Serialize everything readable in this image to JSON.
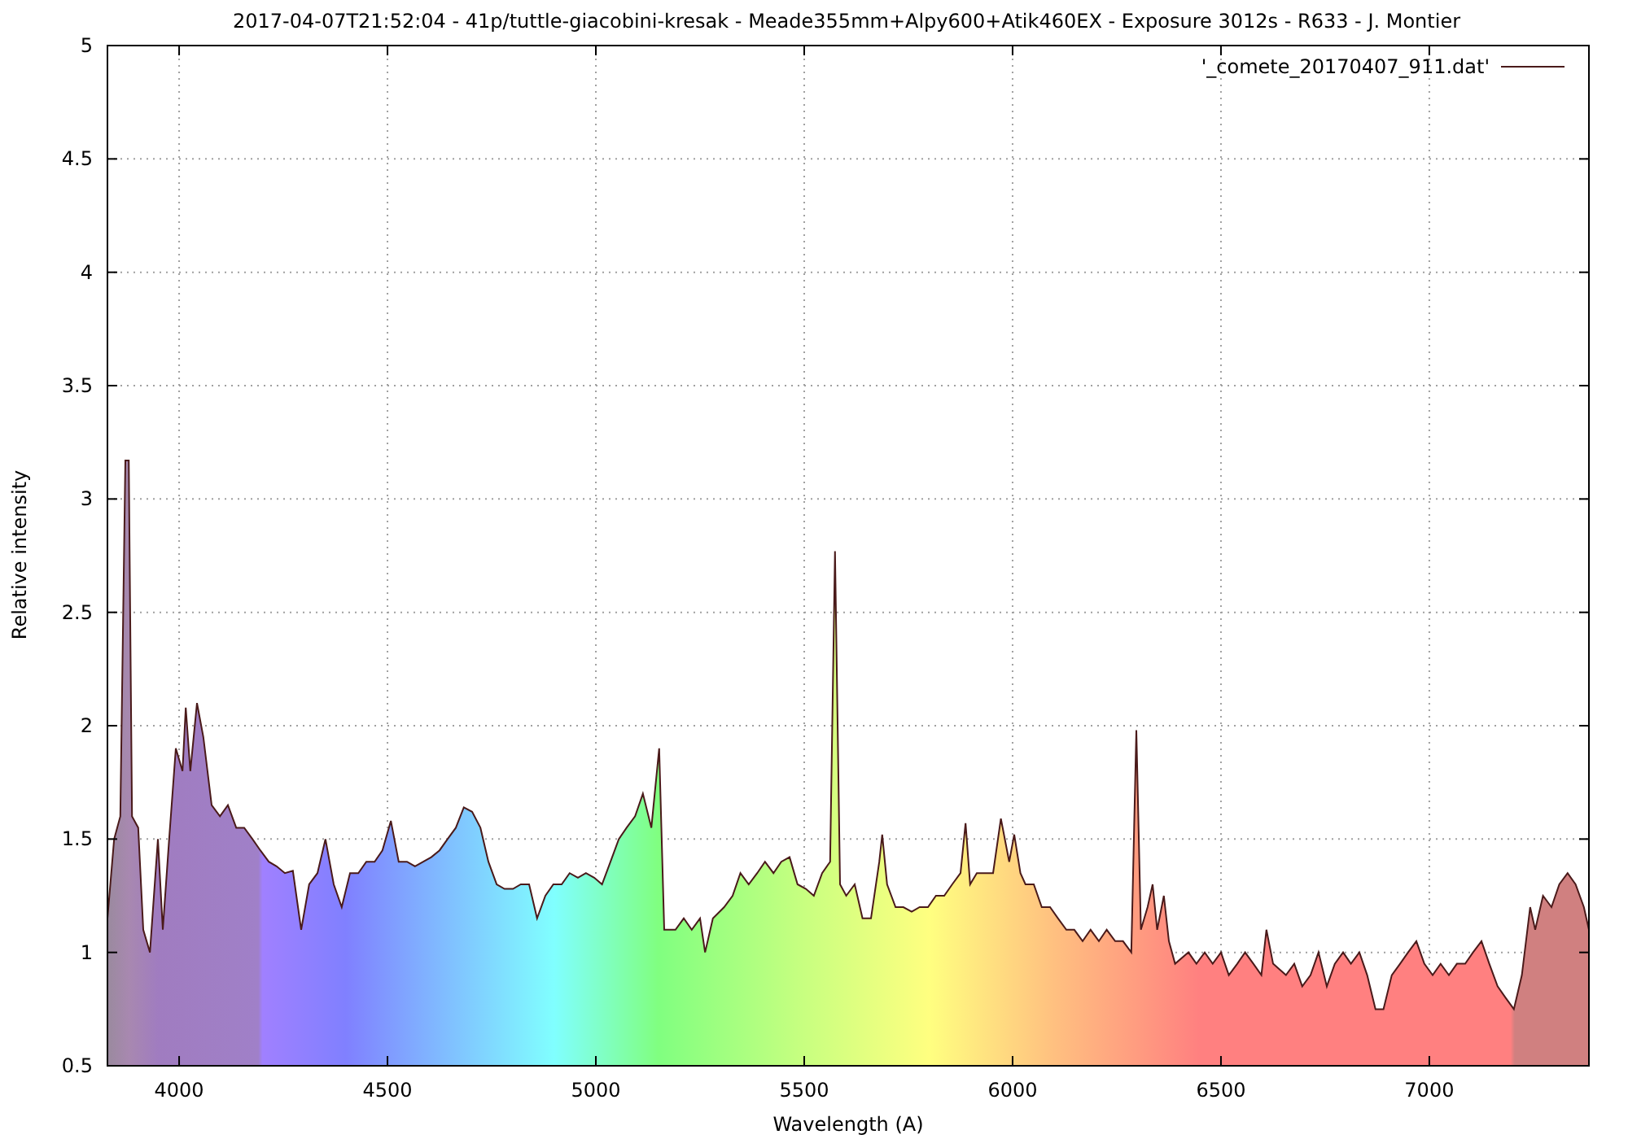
{
  "plot": {
    "chart_data": {
      "type": "area",
      "grid": true,
      "title": "2017-04-07T21:52:04 - 41p/tuttle-giacobini-kresak - Meade355mm+Alpy600+Atik460EX - Exposure 3012s - R633 - J. Montier",
      "xlabel": "Wavelength (A)",
      "ylabel": "Relative intensity",
      "xlim": [
        3828,
        7383
      ],
      "ylim": [
        0.5,
        5
      ],
      "xticks": [
        4000,
        4500,
        5000,
        5500,
        6000,
        6500,
        7000
      ],
      "yticks": [
        0.5,
        1,
        1.5,
        2,
        2.5,
        3,
        3.5,
        4,
        4.5,
        5
      ],
      "x": [
        3828,
        3844,
        3859,
        3871,
        3879,
        3887,
        3902,
        3914,
        3930,
        3949,
        3961,
        3976,
        3992,
        4008,
        4016,
        4027,
        4043,
        4058,
        4078,
        4098,
        4117,
        4137,
        4156,
        4176,
        4195,
        4215,
        4234,
        4254,
        4273,
        4293,
        4312,
        4332,
        4351,
        4371,
        4390,
        4410,
        4430,
        4449,
        4469,
        4488,
        4508,
        4527,
        4547,
        4566,
        4586,
        4605,
        4625,
        4644,
        4664,
        4683,
        4703,
        4723,
        4742,
        4762,
        4781,
        4801,
        4820,
        4840,
        4859,
        4879,
        4898,
        4918,
        4937,
        4957,
        4976,
        4996,
        5015,
        5035,
        5055,
        5074,
        5094,
        5113,
        5133,
        5152,
        5164,
        5191,
        5211,
        5230,
        5250,
        5262,
        5281,
        5308,
        5328,
        5347,
        5367,
        5387,
        5406,
        5426,
        5445,
        5465,
        5484,
        5504,
        5523,
        5543,
        5562,
        5574,
        5586,
        5601,
        5621,
        5640,
        5660,
        5680,
        5687,
        5699,
        5719,
        5738,
        5758,
        5777,
        5797,
        5816,
        5836,
        5855,
        5875,
        5887,
        5898,
        5914,
        5933,
        5953,
        5972,
        5992,
        6004,
        6019,
        6031,
        6051,
        6070,
        6090,
        6109,
        6129,
        6148,
        6168,
        6187,
        6207,
        6226,
        6246,
        6265,
        6285,
        6297,
        6308,
        6324,
        6336,
        6347,
        6363,
        6375,
        6390,
        6422,
        6441,
        6461,
        6480,
        6500,
        6519,
        6539,
        6558,
        6578,
        6597,
        6609,
        6625,
        6656,
        6676,
        6695,
        6715,
        6734,
        6754,
        6773,
        6793,
        6812,
        6832,
        6851,
        6871,
        6890,
        6910,
        6930,
        6949,
        6969,
        6988,
        7008,
        7027,
        7047,
        7066,
        7086,
        7105,
        7125,
        7144,
        7164,
        7183,
        7203,
        7222,
        7242,
        7254,
        7273,
        7293,
        7312,
        7332,
        7351,
        7371,
        7383
      ],
      "series": [
        {
          "name": "'_comete_20170407_911.dat'",
          "color": "#4a1a1a",
          "values": [
            1.15,
            1.5,
            1.6,
            3.17,
            3.17,
            1.6,
            1.55,
            1.1,
            1.0,
            1.5,
            1.1,
            1.5,
            1.9,
            1.8,
            2.08,
            1.8,
            2.1,
            1.95,
            1.65,
            1.6,
            1.65,
            1.55,
            1.55,
            1.5,
            1.45,
            1.4,
            1.38,
            1.35,
            1.36,
            1.1,
            1.3,
            1.35,
            1.5,
            1.3,
            1.2,
            1.35,
            1.35,
            1.4,
            1.4,
            1.45,
            1.58,
            1.4,
            1.4,
            1.38,
            1.4,
            1.42,
            1.45,
            1.5,
            1.55,
            1.64,
            1.62,
            1.55,
            1.4,
            1.3,
            1.28,
            1.28,
            1.3,
            1.3,
            1.15,
            1.25,
            1.3,
            1.3,
            1.35,
            1.33,
            1.35,
            1.33,
            1.3,
            1.4,
            1.5,
            1.55,
            1.6,
            1.7,
            1.55,
            1.9,
            1.1,
            1.1,
            1.15,
            1.1,
            1.15,
            1.0,
            1.15,
            1.2,
            1.25,
            1.35,
            1.3,
            1.35,
            1.4,
            1.35,
            1.4,
            1.42,
            1.3,
            1.28,
            1.25,
            1.35,
            1.4,
            2.77,
            1.3,
            1.25,
            1.3,
            1.15,
            1.15,
            1.4,
            1.52,
            1.3,
            1.2,
            1.2,
            1.18,
            1.2,
            1.2,
            1.25,
            1.25,
            1.3,
            1.35,
            1.57,
            1.3,
            1.35,
            1.35,
            1.35,
            1.59,
            1.4,
            1.52,
            1.35,
            1.3,
            1.3,
            1.2,
            1.2,
            1.15,
            1.1,
            1.1,
            1.05,
            1.1,
            1.05,
            1.1,
            1.05,
            1.05,
            1.0,
            1.98,
            1.1,
            1.2,
            1.3,
            1.1,
            1.25,
            1.05,
            0.95,
            1.0,
            0.95,
            1.0,
            0.95,
            1.0,
            0.9,
            0.95,
            1.0,
            0.95,
            0.9,
            1.1,
            0.95,
            0.9,
            0.95,
            0.85,
            0.9,
            1.0,
            0.85,
            0.95,
            1.0,
            0.95,
            1.0,
            0.9,
            0.75,
            0.75,
            0.9,
            0.95,
            1.0,
            1.05,
            0.95,
            0.9,
            0.95,
            0.9,
            0.95,
            0.95,
            1.0,
            1.05,
            0.95,
            0.85,
            0.8,
            0.75,
            0.9,
            1.2,
            1.1,
            1.25,
            1.2,
            1.3,
            1.35,
            1.3,
            1.2,
            1.1
          ]
        }
      ]
    }
  }
}
